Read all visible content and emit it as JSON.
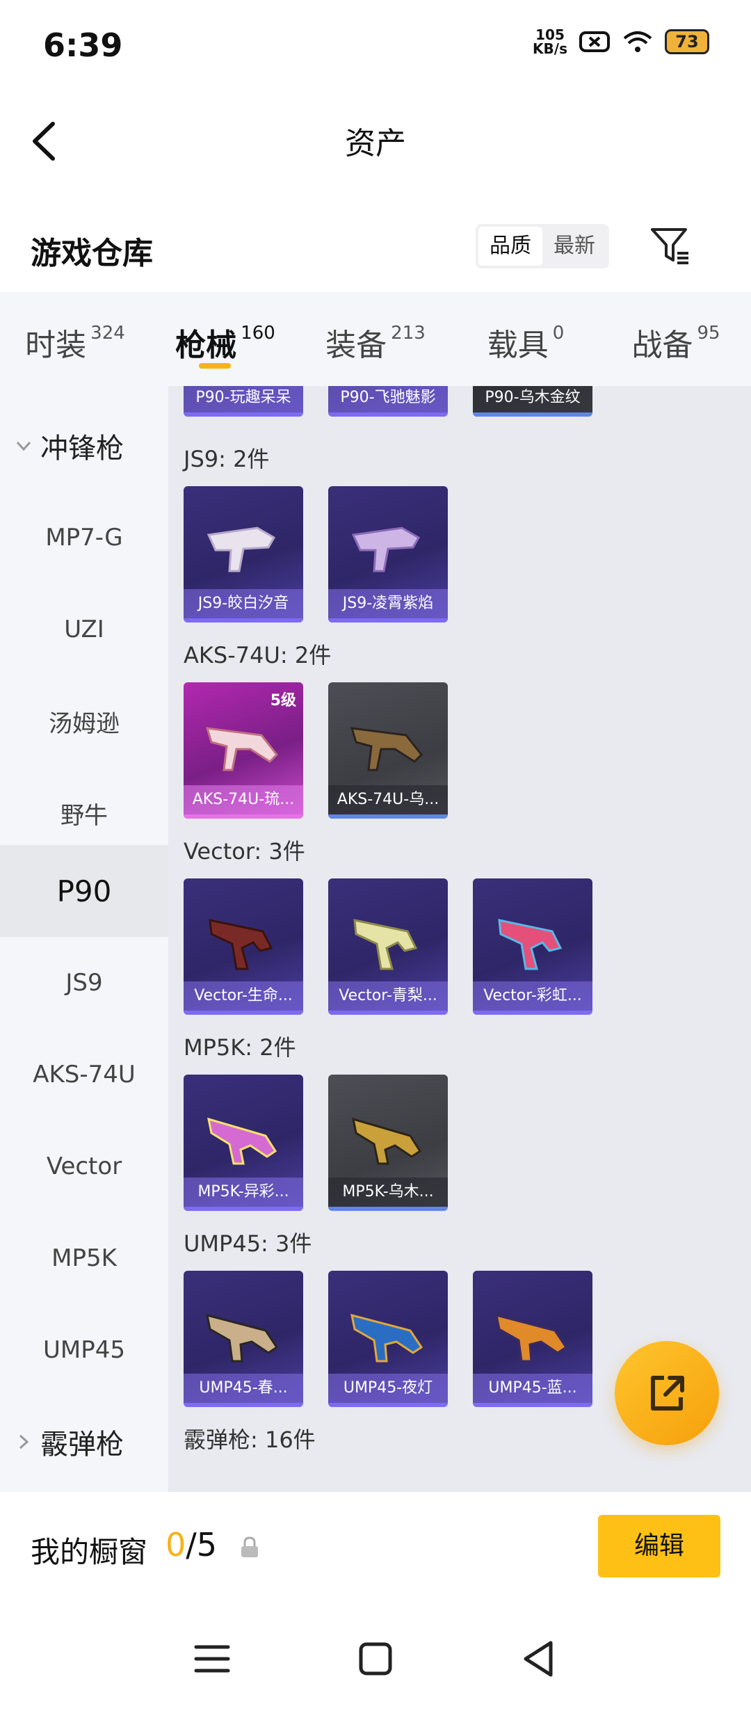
{
  "status": {
    "time": "6:39",
    "net_speed_value": "105",
    "net_speed_unit": "KB/s",
    "battery": "73"
  },
  "header": {
    "title": "资产"
  },
  "warehouse": {
    "title": "游戏仓库",
    "sort_options": [
      "品质",
      "最新"
    ],
    "active_sort": "品质"
  },
  "tabs": [
    {
      "label": "时装",
      "count": "324"
    },
    {
      "label": "枪械",
      "count": "160",
      "active": true
    },
    {
      "label": "装备",
      "count": "213"
    },
    {
      "label": "载具",
      "count": "0"
    },
    {
      "label": "战备",
      "count": "95"
    }
  ],
  "sidebar": {
    "group_open": "冲锋枪",
    "items": [
      "MP7-G",
      "UZI",
      "汤姆逊",
      "野牛",
      "P90",
      "JS9",
      "AKS-74U",
      "Vector",
      "MP5K",
      "UMP45"
    ],
    "active": "P90",
    "group_closed": "霰弹枪"
  },
  "content": {
    "top_cards": [
      "P90-玩趣呆呆",
      "P90-飞驰魅影",
      "P90-乌木金纹"
    ],
    "groups": [
      {
        "title": "JS9: 2件",
        "cards": [
          {
            "label": "JS9-皎白汐音",
            "rarity": "purple"
          },
          {
            "label": "JS9-凌霄紫焰",
            "rarity": "purple"
          }
        ]
      },
      {
        "title": "AKS-74U: 2件",
        "cards": [
          {
            "label": "AKS-74U-琉...",
            "rarity": "pink",
            "level": "5级"
          },
          {
            "label": "AKS-74U-乌...",
            "rarity": "gray"
          }
        ]
      },
      {
        "title": "Vector: 3件",
        "cards": [
          {
            "label": "Vector-生命...",
            "rarity": "purple"
          },
          {
            "label": "Vector-青梨...",
            "rarity": "purple"
          },
          {
            "label": "Vector-彩虹...",
            "rarity": "purple"
          }
        ]
      },
      {
        "title": "MP5K: 2件",
        "cards": [
          {
            "label": "MP5K-异彩...",
            "rarity": "purple"
          },
          {
            "label": "MP5K-乌木...",
            "rarity": "gray"
          }
        ]
      },
      {
        "title": "UMP45: 3件",
        "cards": [
          {
            "label": "UMP45-春...",
            "rarity": "purple"
          },
          {
            "label": "UMP45-夜灯",
            "rarity": "purple"
          },
          {
            "label": "UMP45-蓝...",
            "rarity": "purple"
          }
        ]
      }
    ],
    "shotgun_title": "霰弹枪: 16件"
  },
  "showcase": {
    "title": "我的橱窗",
    "current": "0",
    "max": "/5",
    "edit_label": "编辑"
  },
  "colors": {
    "accent": "#f7b318",
    "purple_card": "#3a2f7a",
    "pink_card": "#b228b0",
    "gray_card": "#4d4e55"
  }
}
